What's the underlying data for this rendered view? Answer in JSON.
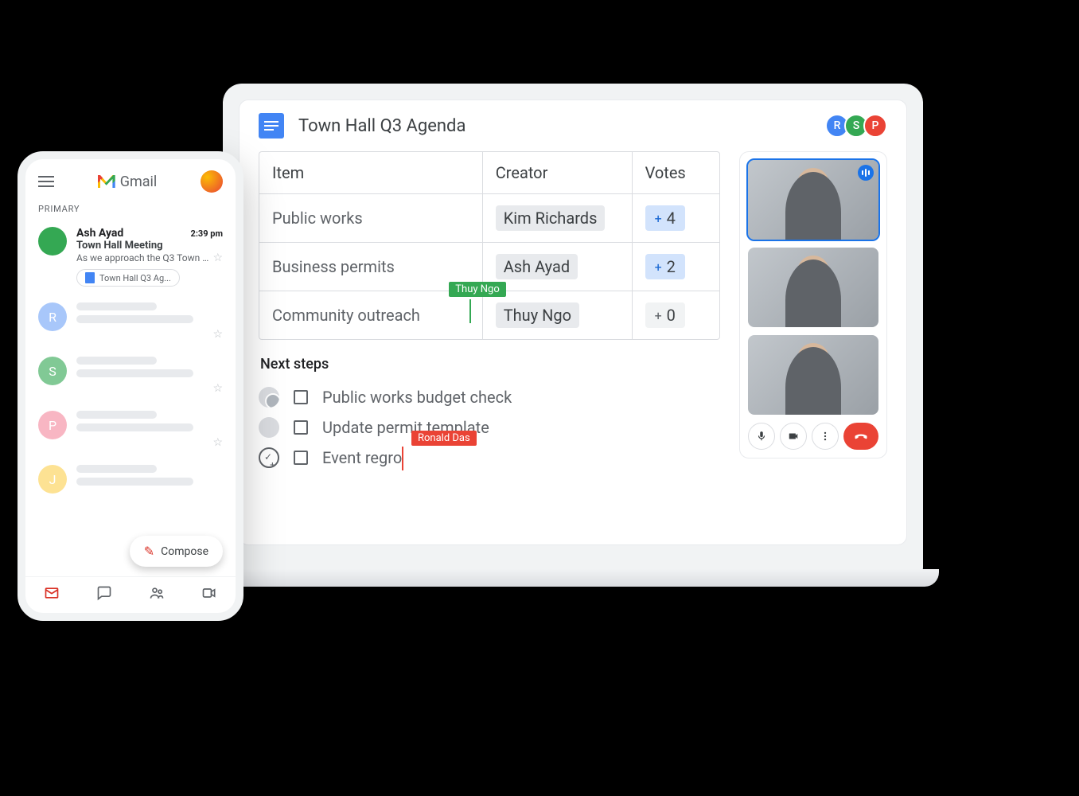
{
  "docs": {
    "title": "Town Hall Q3 Agenda",
    "collaborators": [
      {
        "initial": "R",
        "color": "blue"
      },
      {
        "initial": "S",
        "color": "green"
      },
      {
        "initial": "P",
        "color": "red"
      }
    ],
    "table": {
      "headers": {
        "item": "Item",
        "creator": "Creator",
        "votes": "Votes"
      },
      "rows": [
        {
          "item": "Public works",
          "creator": "Kim Richards",
          "votes": "4"
        },
        {
          "item": "Business permits",
          "creator": "Ash Ayad",
          "votes": "2"
        },
        {
          "item": "Community outreach",
          "creator": "Thuy Ngo",
          "votes": "0"
        }
      ]
    },
    "cursors": {
      "green": "Thuy Ngo",
      "red": "Ronald Das"
    },
    "next_steps_title": "Next steps",
    "steps": [
      {
        "label": "Public works budget check"
      },
      {
        "label": "Update permit template"
      },
      {
        "label": "Event regro"
      }
    ]
  },
  "meet": {
    "controls": {
      "mic": "mic",
      "camera": "camera",
      "more": "more",
      "hangup": "hangup"
    }
  },
  "gmail": {
    "app_name": "Gmail",
    "section": "Primary",
    "compose": "Compose",
    "email": {
      "sender": "Ash Ayad",
      "time": "2:39 pm",
      "subject": "Town Hall Meeting",
      "snippet": "As we approach the Q3 Town Ha...",
      "attachment": "Town Hall Q3 Ag..."
    },
    "placeholder_initials": [
      "R",
      "S",
      "P",
      "J"
    ]
  }
}
